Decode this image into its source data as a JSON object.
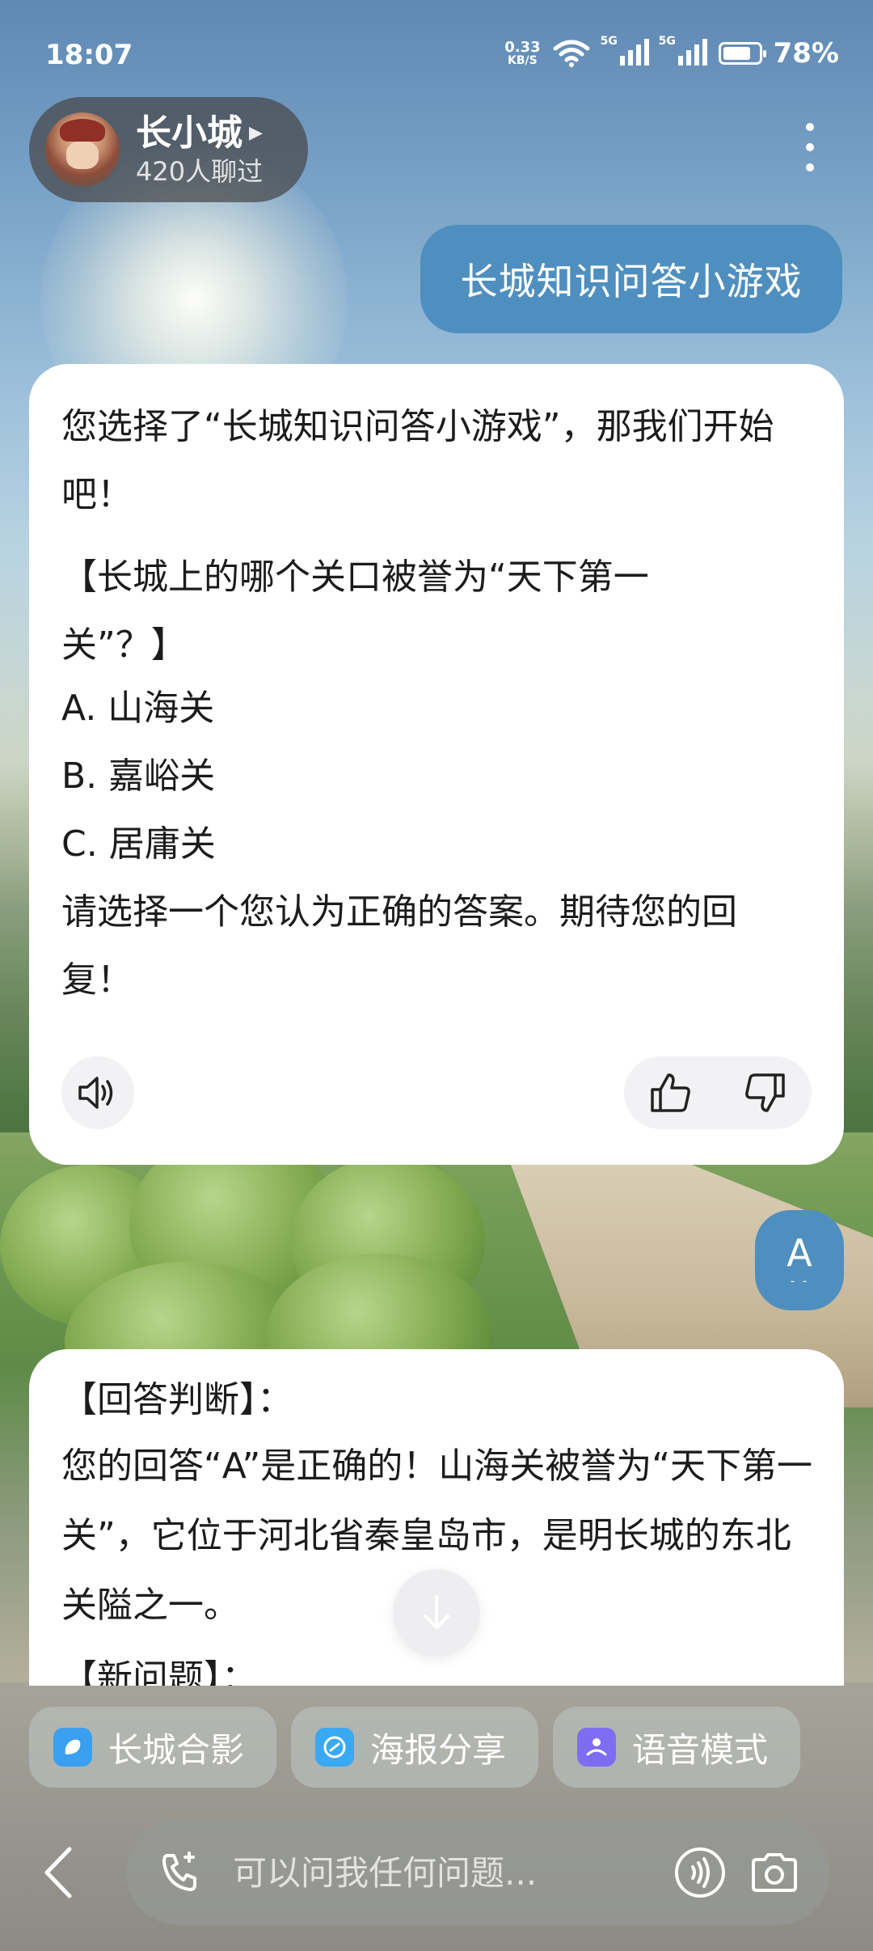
{
  "status_bar": {
    "time": "18:07",
    "net_speed_value": "0.33",
    "net_speed_unit": "KB/S",
    "signal1_label": "5G",
    "signal2_label": "5G",
    "battery_level": 0.78,
    "battery_text": "78%"
  },
  "header": {
    "name": "长小城",
    "subtitle": "420人聊过",
    "more_icon": "more-vertical-icon"
  },
  "messages": {
    "user_1": "长城知识问答小游戏",
    "bot_1": {
      "para1": "您选择了“长城知识问答小游戏”，那我们开始吧！",
      "question": "【长城上的哪个关口被誉为“天下第一关”？】",
      "options": [
        "A. 山海关",
        "B. 嘉峪关",
        "C. 居庸关"
      ],
      "closing": "请选择一个您认为正确的答案。期待您的回复！"
    },
    "user_2": "A",
    "user_2_sub": "- -",
    "bot_2": {
      "heading": "【回答判断】：",
      "body": "您的回答“A”是正确的！山海关被誉为“天下第一关”，它位于河北省秦皇岛市，是明长城的东北关隘之一。",
      "next_heading_partial": "【新问题】："
    }
  },
  "chips": [
    {
      "label": "长城合影",
      "icon": "photo-icon",
      "color": "#3b9ff0"
    },
    {
      "label": "海报分享",
      "icon": "link-icon",
      "color": "#39a9f4"
    },
    {
      "label": "语音模式",
      "icon": "voice-mode-icon",
      "color": "#7f6cf2"
    }
  ],
  "input": {
    "placeholder": "可以问我任何问题..."
  },
  "colors": {
    "accent": "#4f8fbf",
    "card_bg": "#ffffff"
  }
}
